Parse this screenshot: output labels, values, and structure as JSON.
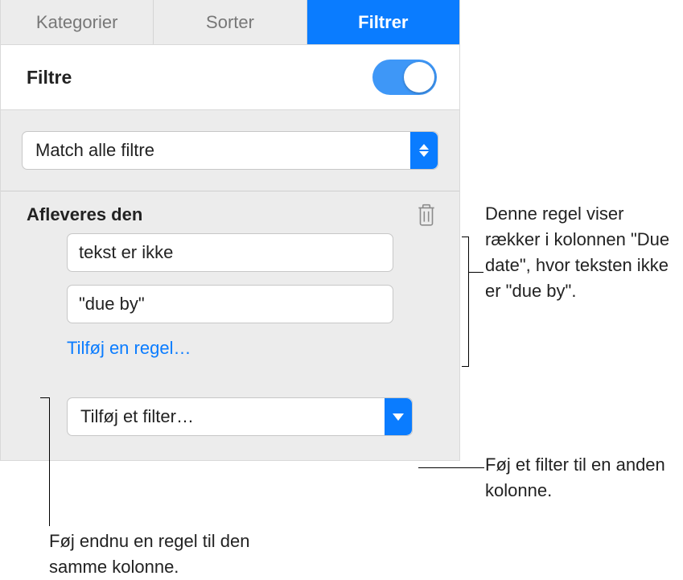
{
  "tabs": {
    "categories": "Kategorier",
    "sort": "Sorter",
    "filter": "Filtrer"
  },
  "header": {
    "title": "Filtre"
  },
  "match_select": "Match alle filtre",
  "rule": {
    "title": "Afleveres den",
    "condition": "tekst er ikke",
    "value": "\"due by\""
  },
  "add_rule_label": "Tilføj en regel…",
  "add_filter_select": "Tilføj et filter…",
  "callouts": {
    "rule_desc": "Denne regel viser rækker i kolonnen \"Due date\", hvor teksten ikke er \"due by\".",
    "add_filter": "Føj et filter til en anden kolonne.",
    "add_rule": "Føj endnu en regel til den samme kolonne."
  }
}
